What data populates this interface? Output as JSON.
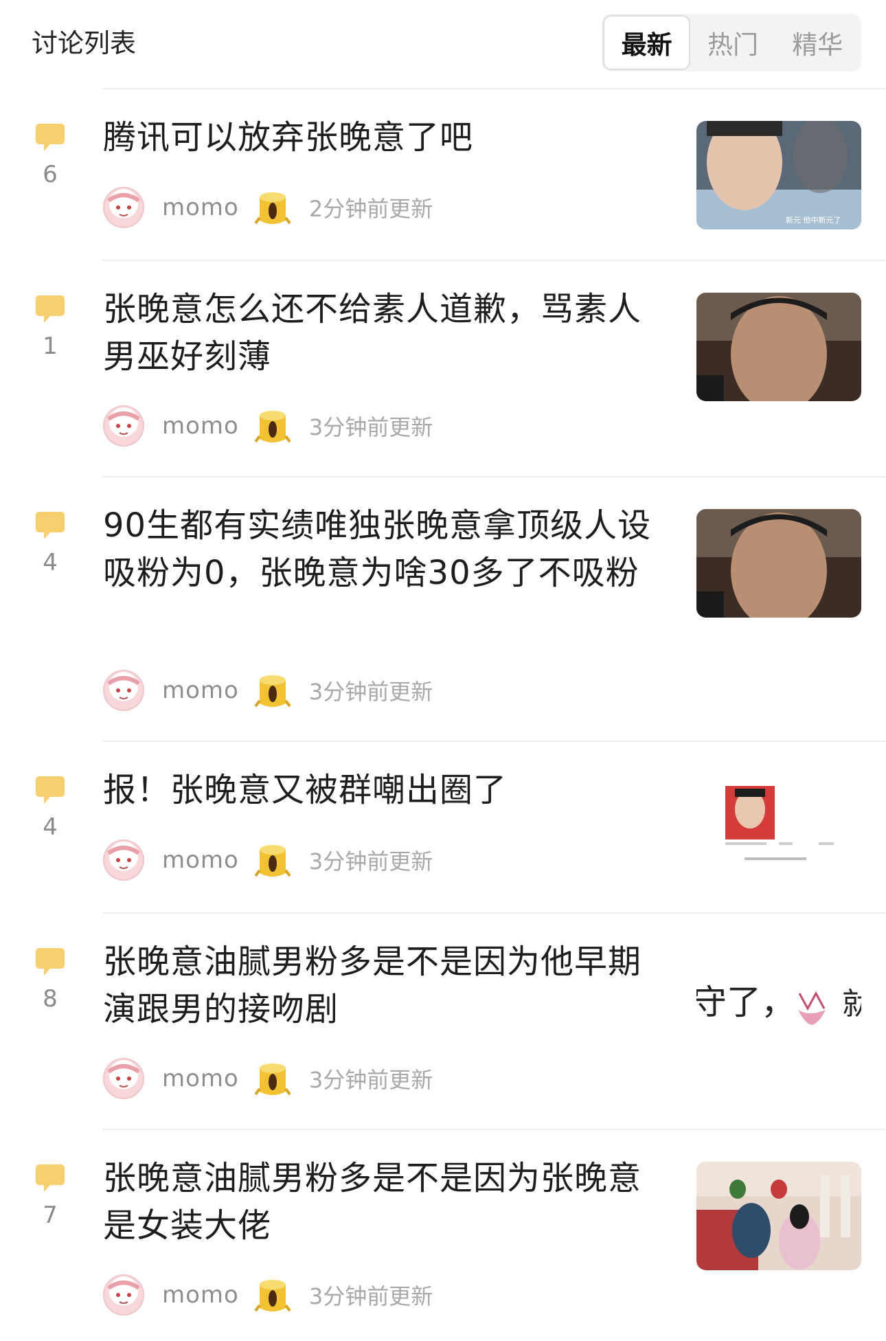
{
  "header": {
    "title": "讨论列表",
    "tabs": [
      {
        "label": "最新",
        "active": true
      },
      {
        "label": "热门",
        "active": false
      },
      {
        "label": "精华",
        "active": false
      }
    ]
  },
  "posts": [
    {
      "title": "腾讯可以放弃张晚意了吧",
      "comments": "6",
      "user": "momo",
      "time": "2分钟前更新",
      "thumb_caption": "新元 他中新元了"
    },
    {
      "title": "张晚意怎么还不给素人道歉，骂素人男巫好刻薄",
      "comments": "1",
      "user": "momo",
      "time": "3分钟前更新"
    },
    {
      "title": "90生都有实绩唯独张晚意拿顶级人设吸粉为0，张晚意为啥30多了不吸粉",
      "comments": "4",
      "user": "momo",
      "time": "3分钟前更新"
    },
    {
      "title": "报！张晚意又被群嘲出圈了",
      "comments": "4",
      "user": "momo",
      "time": "3分钟前更新"
    },
    {
      "title": "张晚意油腻男粉多是不是因为他早期演跟男的接吻剧",
      "comments": "8",
      "user": "momo",
      "time": "3分钟前更新",
      "thumb_text": "守了，",
      "thumb_text2": "就"
    },
    {
      "title": "张晚意油腻男粉多是不是因为张晚意是女装大佬",
      "comments": "7",
      "user": "momo",
      "time": "3分钟前更新"
    }
  ],
  "colors": {
    "bubble": "#f8cf6e",
    "accent_text": "#111111",
    "muted_text": "#8e8e8e"
  },
  "icons": {
    "comment": "speech-bubble-icon",
    "badge": "tree-stump-icon",
    "avatar": "avatar"
  }
}
